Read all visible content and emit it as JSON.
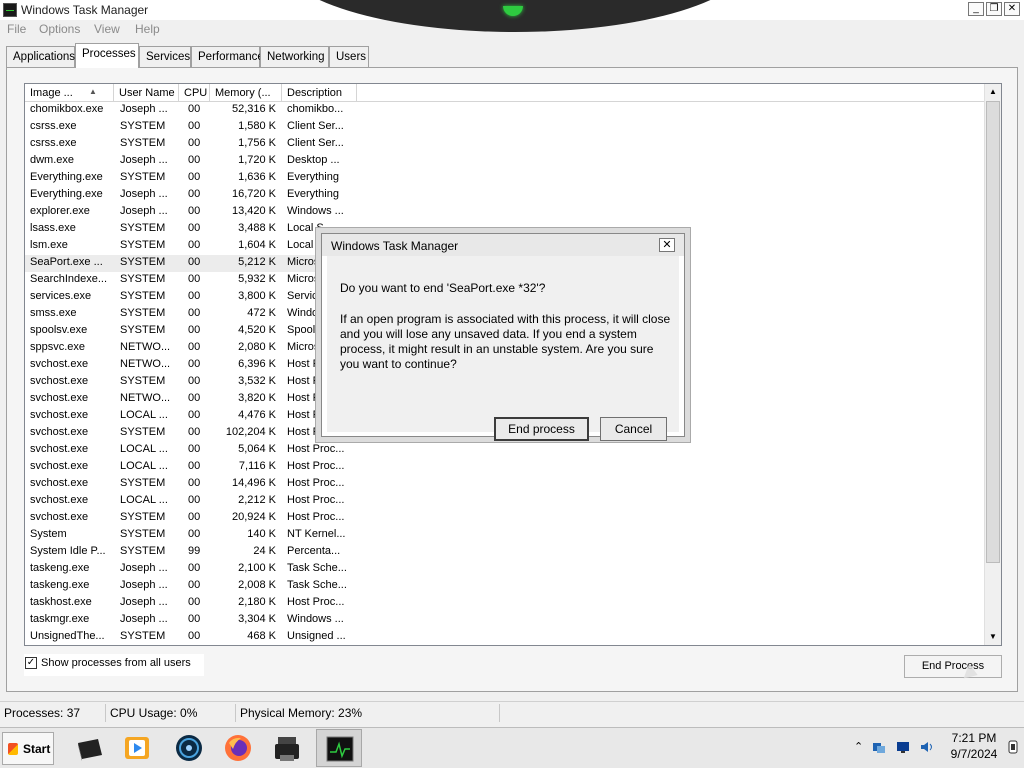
{
  "window": {
    "title": "Windows Task Manager"
  },
  "menu": [
    "File",
    "Options",
    "View",
    "Help"
  ],
  "tabs": [
    "Applications",
    "Processes",
    "Services",
    "Performance",
    "Networking",
    "Users"
  ],
  "active_tab": "Processes",
  "columns": [
    "Image ...",
    "User Name",
    "CPU",
    "Memory (...",
    "Description"
  ],
  "processes": [
    {
      "name": "chomikbox.exe",
      "user": "Joseph ...",
      "cpu": "00",
      "mem": "52,316 K",
      "desc": "chomikbo..."
    },
    {
      "name": "csrss.exe",
      "user": "SYSTEM",
      "cpu": "00",
      "mem": "1,580 K",
      "desc": "Client Ser..."
    },
    {
      "name": "csrss.exe",
      "user": "SYSTEM",
      "cpu": "00",
      "mem": "1,756 K",
      "desc": "Client Ser..."
    },
    {
      "name": "dwm.exe",
      "user": "Joseph ...",
      "cpu": "00",
      "mem": "1,720 K",
      "desc": "Desktop ..."
    },
    {
      "name": "Everything.exe",
      "user": "SYSTEM",
      "cpu": "00",
      "mem": "1,636 K",
      "desc": "Everything"
    },
    {
      "name": "Everything.exe",
      "user": "Joseph ...",
      "cpu": "00",
      "mem": "16,720 K",
      "desc": "Everything"
    },
    {
      "name": "explorer.exe",
      "user": "Joseph ...",
      "cpu": "00",
      "mem": "13,420 K",
      "desc": "Windows ..."
    },
    {
      "name": "lsass.exe",
      "user": "SYSTEM",
      "cpu": "00",
      "mem": "3,488 K",
      "desc": "Local S..."
    },
    {
      "name": "lsm.exe",
      "user": "SYSTEM",
      "cpu": "00",
      "mem": "1,604 K",
      "desc": "Local S..."
    },
    {
      "name": "SeaPort.exe ...",
      "user": "SYSTEM",
      "cpu": "00",
      "mem": "5,212 K",
      "desc": "Microso..."
    },
    {
      "name": "SearchIndexe...",
      "user": "SYSTEM",
      "cpu": "00",
      "mem": "5,932 K",
      "desc": "Microso..."
    },
    {
      "name": "services.exe",
      "user": "SYSTEM",
      "cpu": "00",
      "mem": "3,800 K",
      "desc": "Service..."
    },
    {
      "name": "smss.exe",
      "user": "SYSTEM",
      "cpu": "00",
      "mem": "472 K",
      "desc": "Window..."
    },
    {
      "name": "spoolsv.exe",
      "user": "SYSTEM",
      "cpu": "00",
      "mem": "4,520 K",
      "desc": "Spooler..."
    },
    {
      "name": "sppsvc.exe",
      "user": "NETWO...",
      "cpu": "00",
      "mem": "2,080 K",
      "desc": "Microso..."
    },
    {
      "name": "svchost.exe",
      "user": "NETWO...",
      "cpu": "00",
      "mem": "6,396 K",
      "desc": "Host Pr..."
    },
    {
      "name": "svchost.exe",
      "user": "SYSTEM",
      "cpu": "00",
      "mem": "3,532 K",
      "desc": "Host Pr..."
    },
    {
      "name": "svchost.exe",
      "user": "NETWO...",
      "cpu": "00",
      "mem": "3,820 K",
      "desc": "Host Pr..."
    },
    {
      "name": "svchost.exe",
      "user": "LOCAL ...",
      "cpu": "00",
      "mem": "4,476 K",
      "desc": "Host Pr..."
    },
    {
      "name": "svchost.exe",
      "user": "SYSTEM",
      "cpu": "00",
      "mem": "102,204 K",
      "desc": "Host Pr..."
    },
    {
      "name": "svchost.exe",
      "user": "LOCAL ...",
      "cpu": "00",
      "mem": "5,064 K",
      "desc": "Host Proc..."
    },
    {
      "name": "svchost.exe",
      "user": "LOCAL ...",
      "cpu": "00",
      "mem": "7,116 K",
      "desc": "Host Proc..."
    },
    {
      "name": "svchost.exe",
      "user": "SYSTEM",
      "cpu": "00",
      "mem": "14,496 K",
      "desc": "Host Proc..."
    },
    {
      "name": "svchost.exe",
      "user": "LOCAL ...",
      "cpu": "00",
      "mem": "2,212 K",
      "desc": "Host Proc..."
    },
    {
      "name": "svchost.exe",
      "user": "SYSTEM",
      "cpu": "00",
      "mem": "20,924 K",
      "desc": "Host Proc..."
    },
    {
      "name": "System",
      "user": "SYSTEM",
      "cpu": "00",
      "mem": "140 K",
      "desc": "NT Kernel..."
    },
    {
      "name": "System Idle P...",
      "user": "SYSTEM",
      "cpu": "99",
      "mem": "24 K",
      "desc": "Percenta..."
    },
    {
      "name": "taskeng.exe",
      "user": "Joseph ...",
      "cpu": "00",
      "mem": "2,100 K",
      "desc": "Task Sche..."
    },
    {
      "name": "taskeng.exe",
      "user": "Joseph ...",
      "cpu": "00",
      "mem": "2,008 K",
      "desc": "Task Sche..."
    },
    {
      "name": "taskhost.exe",
      "user": "Joseph ...",
      "cpu": "00",
      "mem": "2,180 K",
      "desc": "Host Proc..."
    },
    {
      "name": "taskmgr.exe",
      "user": "Joseph ...",
      "cpu": "00",
      "mem": "3,304 K",
      "desc": "Windows ..."
    },
    {
      "name": "UnsignedThe...",
      "user": "SYSTEM",
      "cpu": "00",
      "mem": "468 K",
      "desc": "Unsigned ..."
    }
  ],
  "selected_process": "SeaPort.exe ...",
  "show_all": {
    "label": "Show processes from all users",
    "checked": true
  },
  "end_process_button": "End Process",
  "status": {
    "processes": "Processes: 37",
    "cpu": "CPU Usage: 0%",
    "memory": "Physical Memory: 23%"
  },
  "dialog": {
    "title": "Windows Task Manager",
    "question": "Do you want to end 'SeaPort.exe *32'?",
    "warning": "If an open program is associated with this process, it will close and you will lose any unsaved data. If you end a system process, it might result in an unstable system. Are you sure you want to continue?",
    "confirm": "End process",
    "cancel": "Cancel",
    "close_glyph": "✕"
  },
  "taskbar": {
    "start": "Start",
    "apps": [
      "terminal-app",
      "media-player-app",
      "globe-app",
      "firefox-app",
      "printer-app",
      "task-manager-app"
    ],
    "active_app": "task-manager-app",
    "clock_time": "7:21 PM",
    "clock_date": "9/7/2024"
  },
  "colors": {
    "selection": "#ececec",
    "notch_led": "#2ecc40"
  }
}
